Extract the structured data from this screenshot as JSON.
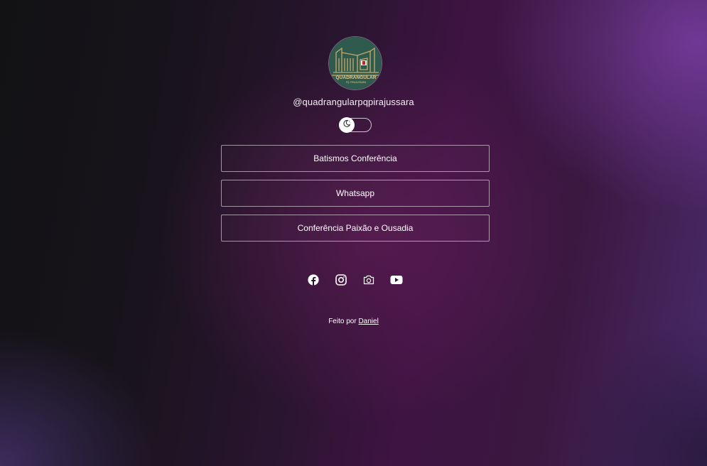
{
  "profile": {
    "username": "@quadrangularpqpirajussara",
    "logo_text": "QUADRANGULAR",
    "logo_subtext": "PQ. PIRAJUSSARA"
  },
  "theme_toggle": {
    "icon": "moon-icon",
    "state": "dark"
  },
  "links": [
    {
      "label": "Batismos Conferência"
    },
    {
      "label": "Whatsapp"
    },
    {
      "label": "Conferência Paixão e Ousadia"
    }
  ],
  "social": [
    "facebook-icon",
    "instagram-icon",
    "camera-icon",
    "youtube-icon"
  ],
  "footer": {
    "prefix": "Feito por",
    "author": "Daniel"
  }
}
